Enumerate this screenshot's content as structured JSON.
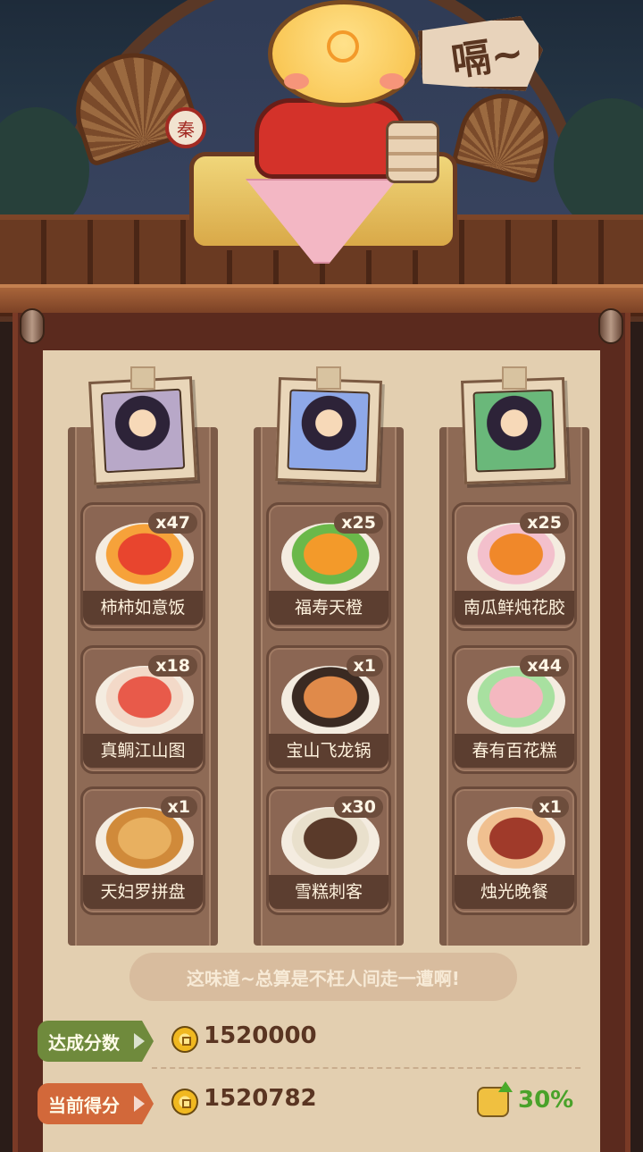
{
  "sign_text": "嗝~",
  "ladle_text": "秦",
  "columns": [
    {
      "portrait_color": "#b8a8c8",
      "dishes": [
        {
          "name": "柿柿如意饭",
          "qty": "x47",
          "c1": "#e8452e",
          "c2": "#f6a23a"
        },
        {
          "name": "真鲷江山图",
          "qty": "x18",
          "c1": "#e85a4a",
          "c2": "#f3d9c8"
        },
        {
          "name": "天妇罗拼盘",
          "qty": "x1",
          "c1": "#e8b060",
          "c2": "#d08a3a"
        }
      ]
    },
    {
      "portrait_color": "#8ea8e8",
      "dishes": [
        {
          "name": "福寿天橙",
          "qty": "x25",
          "c1": "#f39a2a",
          "c2": "#6ab84a"
        },
        {
          "name": "宝山飞龙锅",
          "qty": "x1",
          "c1": "#e08a4a",
          "c2": "#3a2a22"
        },
        {
          "name": "雪糕刺客",
          "qty": "x30",
          "c1": "#5a3a2a",
          "c2": "#e9e0cc"
        }
      ]
    },
    {
      "portrait_color": "#6ab87a",
      "dishes": [
        {
          "name": "南瓜鲜炖花胶",
          "qty": "x25",
          "c1": "#f0882a",
          "c2": "#f3c0cc"
        },
        {
          "name": "春有百花糕",
          "qty": "x44",
          "c1": "#f4b8c0",
          "c2": "#a8e0a0"
        },
        {
          "name": "烛光晚餐",
          "qty": "x1",
          "c1": "#a03a2a",
          "c2": "#f0c090"
        }
      ]
    }
  ],
  "quote": "这味道~总算是不枉人间走一遭啊!",
  "target": {
    "label": "达成分数",
    "value": "1520000",
    "color": "#6f8a3c"
  },
  "current": {
    "label": "当前得分",
    "value": "1520782",
    "color": "#d2683a"
  },
  "bonus": "30%"
}
